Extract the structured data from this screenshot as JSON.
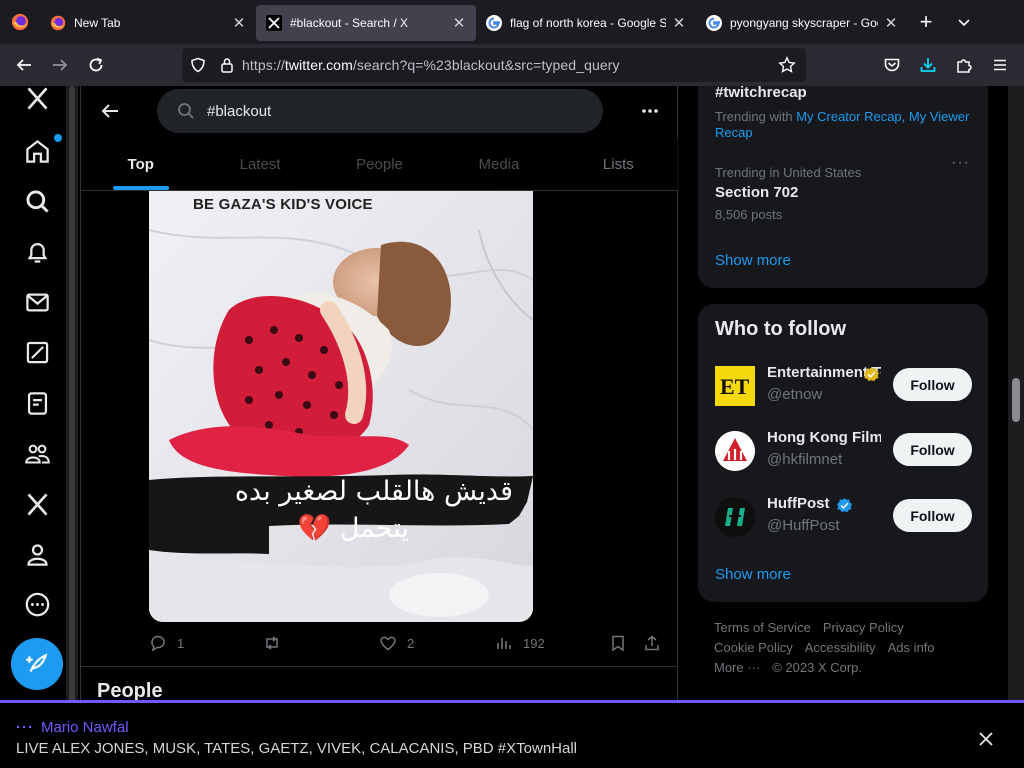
{
  "browser": {
    "tabs": [
      {
        "title": "New Tab",
        "active": false,
        "favicon": "firefox-icon"
      },
      {
        "title": "#blackout - Search / X",
        "active": true,
        "favicon": "x-logo-icon"
      },
      {
        "title": "flag of north korea - Google Se",
        "active": false,
        "favicon": "google-icon"
      },
      {
        "title": "pyongyang skyscraper - Google",
        "active": false,
        "favicon": "google-icon"
      }
    ],
    "url_prefix": "https://",
    "url_host": "twitter.com",
    "url_path": "/search?q=%23blackout&src=typed_query"
  },
  "search": {
    "query": "#blackout"
  },
  "search_tabs": [
    "Top",
    "Latest",
    "People",
    "Media",
    "Lists"
  ],
  "post": {
    "media_caption": "BE GAZA'S KID'S VOICE",
    "arabic_line1": "قديش هالقلب لصغير بده",
    "arabic_line2": "يتحمل 💔",
    "replies": "1",
    "likes": "2",
    "views": "192"
  },
  "people_heading": "People",
  "trends": {
    "top_name": "#twitchrecap",
    "top_sub_prefix": "Trending with",
    "top_link1": "My Creator Recap,",
    "top_link2": "My Viewer Recap",
    "second_context": "Trending in United States",
    "second_name": "Section 702",
    "second_count": "8,506 posts",
    "show_more": "Show more"
  },
  "who_to_follow": {
    "title": "Who to follow",
    "accounts": [
      {
        "name": "Entertainment Tonight",
        "handle": "@etnow",
        "verified": "gold",
        "follow": "Follow"
      },
      {
        "name": "Hong Kong Film",
        "handle": "@hkfilmnet",
        "verified": "none",
        "follow": "Follow"
      },
      {
        "name": "HuffPost",
        "handle": "@HuffPost",
        "verified": "blue",
        "follow": "Follow"
      }
    ],
    "show_more": "Show more"
  },
  "footer": {
    "terms": "Terms of Service",
    "privacy": "Privacy Policy",
    "cookie": "Cookie Policy",
    "accessibility": "Accessibility",
    "ads": "Ads info",
    "more": "More ···",
    "copyright": "© 2023 X Corp."
  },
  "spaces": {
    "host": "Mario Nawfal",
    "title": "LIVE ALEX JONES, MUSK, TATES, GAETZ, VIVEK, CALACANIS, PBD #XTownHall"
  },
  "colors": {
    "accent": "#1d9bf0",
    "spaces": "#7856ff",
    "background": "#000000"
  }
}
